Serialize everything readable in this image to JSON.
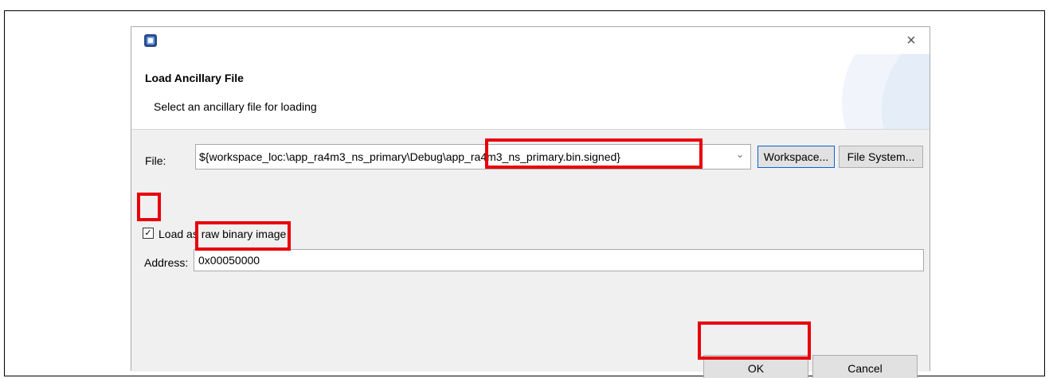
{
  "dialog": {
    "close_glyph": "×",
    "title": "Load Ancillary File",
    "subtitle": "Select an ancillary file for loading"
  },
  "file": {
    "label": "File:",
    "value": "${workspace_loc:\\app_ra4m3_ns_primary\\Debug\\app_ra4m3_ns_primary.bin.signed}",
    "dropdown_glyph": "⌄",
    "workspace_button": "Workspace...",
    "filesystem_button": "File System..."
  },
  "raw_binary": {
    "checked": true,
    "check_glyph": "✓",
    "label": "Load as raw binary image"
  },
  "address": {
    "label": "Address:",
    "value": "0x00050000"
  },
  "buttons": {
    "ok": "OK",
    "cancel": "Cancel"
  },
  "colors": {
    "highlight": "#e8000b",
    "focus_border": "#0a64d8"
  }
}
